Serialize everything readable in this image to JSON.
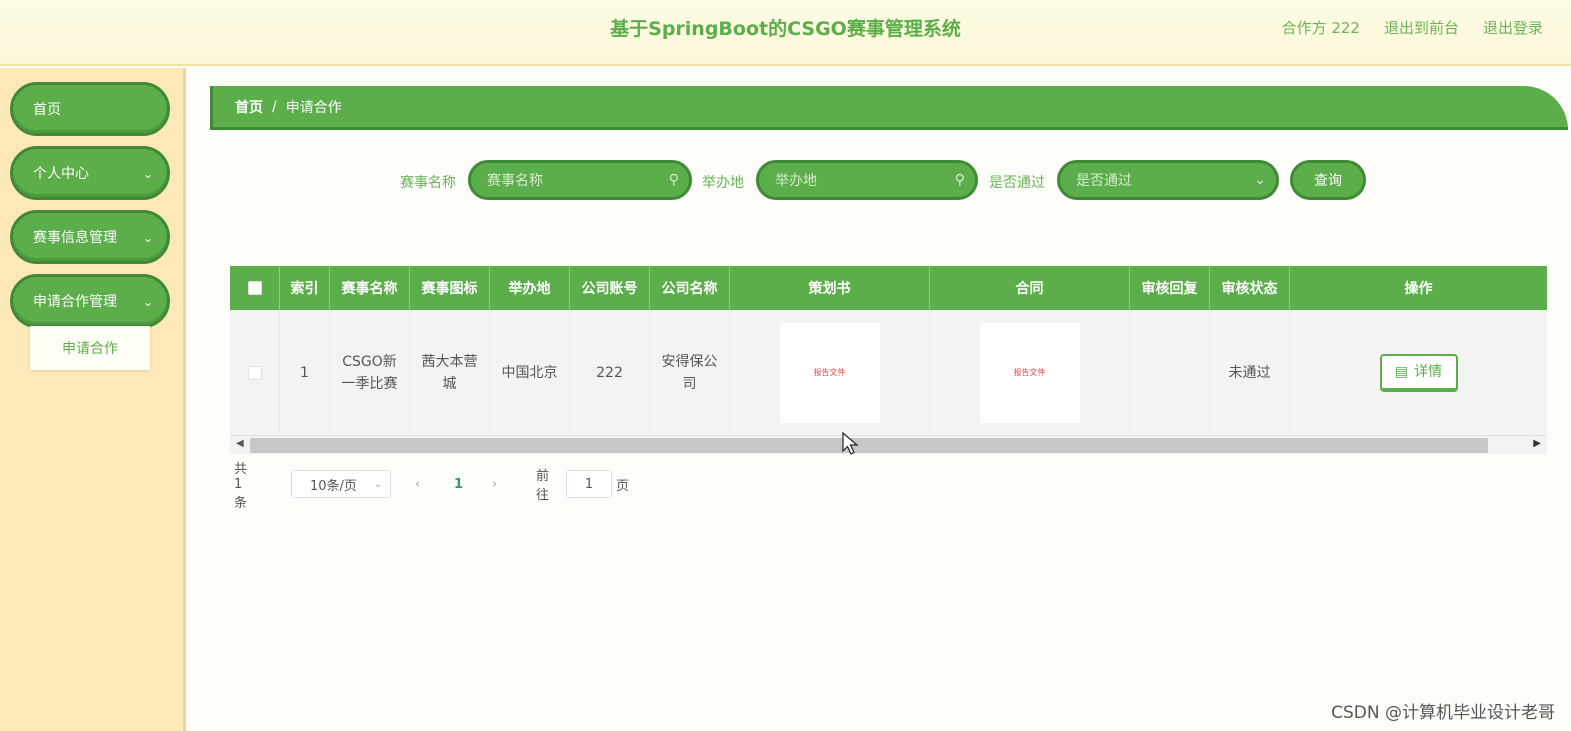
{
  "header": {
    "title": "基于SpringBoot的CSGO赛事管理系统",
    "user": "合作方 222",
    "front_link": "退出到前台",
    "logout_link": "退出登录"
  },
  "sidebar": {
    "items": [
      {
        "label": "首页"
      },
      {
        "label": "个人中心"
      },
      {
        "label": "赛事信息管理"
      },
      {
        "label": "申请合作管理"
      }
    ],
    "submenu_item": "申请合作"
  },
  "breadcrumb": {
    "home": "首页",
    "separator": "/",
    "current": "申请合作"
  },
  "search": {
    "event_label": "赛事名称",
    "event_placeholder": "赛事名称",
    "venue_label": "举办地",
    "venue_placeholder": "举办地",
    "approved_label": "是否通过",
    "approved_placeholder": "是否通过",
    "query_button": "查询"
  },
  "table": {
    "headers": [
      "索引",
      "赛事名称",
      "赛事图标",
      "举办地",
      "公司账号",
      "公司名称",
      "策划书",
      "合同",
      "审核回复",
      "审核状态",
      "操作"
    ],
    "rows": [
      {
        "index": "1",
        "event_name": "CSGO新一季比赛",
        "event_icon": "茜大本营城",
        "venue": "中国北京",
        "company_account": "222",
        "company_name": "安得保公司",
        "plan_thumb": "报告文件",
        "contract_thumb": "报告文件",
        "review_reply": "",
        "review_status": "未通过",
        "action": "详情"
      }
    ]
  },
  "pagination": {
    "total": "共 1 条",
    "page_size": "10条/页",
    "current_page": "1",
    "goto_label": "前往",
    "goto_value": "1",
    "page_suffix": "页"
  },
  "watermark": "CSDN @计算机毕业设计老哥",
  "colors": {
    "accent": "#5cae4a",
    "accent_dark": "#3f8a36",
    "sidebar_bg": "#ffe8b8"
  }
}
